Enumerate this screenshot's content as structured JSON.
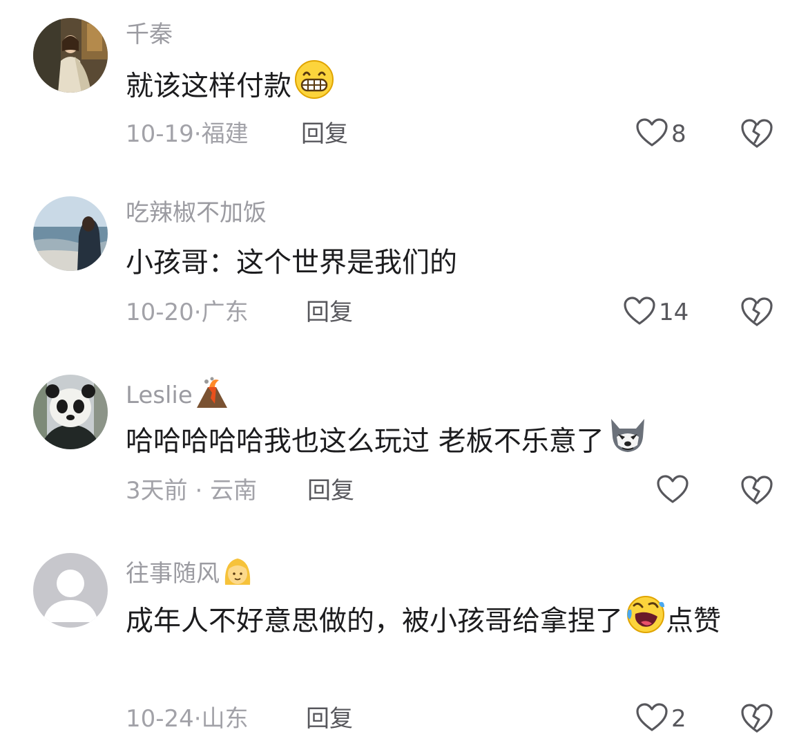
{
  "reply_label": "回复",
  "comments": [
    {
      "username": "千秦",
      "text": "就该这样付款",
      "date": "10-19",
      "location": "福建",
      "likes": "8",
      "name_emoji": "",
      "text_emoji": "grinning-face-emoji",
      "avatar": "photo-woman-indoor"
    },
    {
      "username": "吃辣椒不加饭",
      "text": "小孩哥：这个世界是我们的",
      "date": "10-20",
      "location": "广东",
      "likes": "14",
      "name_emoji": "",
      "text_emoji": "",
      "avatar": "photo-woman-beach"
    },
    {
      "username": "Leslie",
      "text": "哈哈哈哈哈我也这么玩过 老板不乐意了",
      "date": "3天前",
      "location": "云南",
      "likes": "",
      "name_emoji": "volcano-emoji",
      "text_emoji": "husky-dog-emoji",
      "avatar": "photo-panda"
    },
    {
      "username": "往事随风",
      "text": "成年人不好意思做的，被小孩哥给拿捏了",
      "text_tail": "点赞",
      "date": "10-24",
      "location": "山东",
      "likes": "2",
      "name_emoji": "person-blond-emoji",
      "text_emoji": "rolling-laughing-emoji",
      "avatar": "default-gray-avatar"
    }
  ],
  "colors": {
    "name": "#9b9ba1",
    "text": "#1c1c1e",
    "meta": "#a2a2a8",
    "action": "#57575c"
  }
}
